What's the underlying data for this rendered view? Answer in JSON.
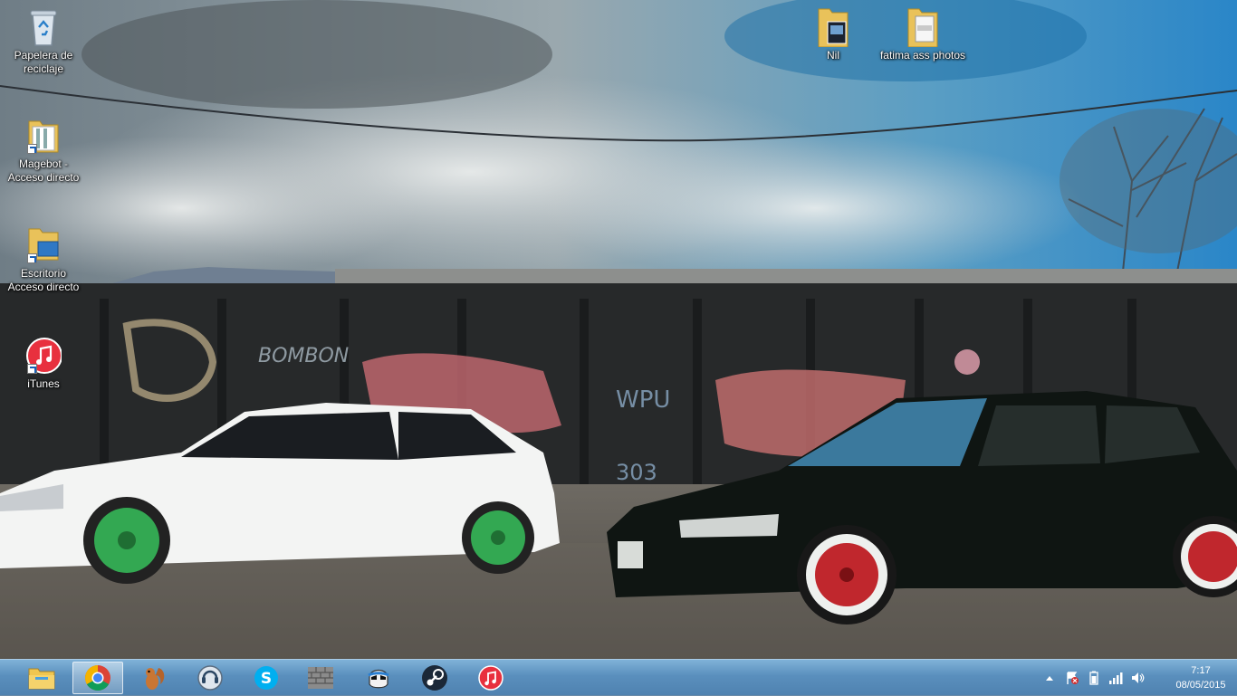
{
  "desktop": {
    "icons": [
      {
        "name": "recycle-bin",
        "label": "Papelera de reciclaje",
        "icon": "recycle-bin-icon"
      },
      {
        "name": "magebot",
        "label": "Magebot - Acceso directo",
        "icon": "folder-icon"
      },
      {
        "name": "escritorio",
        "label": "Escritorio Acceso directo",
        "icon": "folder-icon"
      },
      {
        "name": "itunes",
        "label": "iTunes",
        "icon": "itunes-icon"
      },
      {
        "name": "nil",
        "label": "Nil",
        "icon": "folder-icon"
      },
      {
        "name": "fatima",
        "label": "fatima ass photos",
        "icon": "folder-icon"
      }
    ]
  },
  "taskbar": {
    "pinned": [
      {
        "name": "file-explorer",
        "icon": "folder-icon",
        "active": false
      },
      {
        "name": "chrome",
        "icon": "chrome-icon",
        "active": true
      },
      {
        "name": "squirrel-app",
        "icon": "squirrel-icon",
        "active": false
      },
      {
        "name": "teamspeak",
        "icon": "teamspeak-icon",
        "active": false
      },
      {
        "name": "skype",
        "icon": "skype-icon",
        "active": false
      },
      {
        "name": "minecraft",
        "icon": "brick-icon",
        "active": false
      },
      {
        "name": "stormtrooper-app",
        "icon": "helmet-icon",
        "active": false
      },
      {
        "name": "steam",
        "icon": "steam-icon",
        "active": false
      },
      {
        "name": "itunes",
        "icon": "itunes-icon",
        "active": false
      }
    ],
    "tray": {
      "time": "7:17",
      "date": "08/05/2015"
    }
  }
}
